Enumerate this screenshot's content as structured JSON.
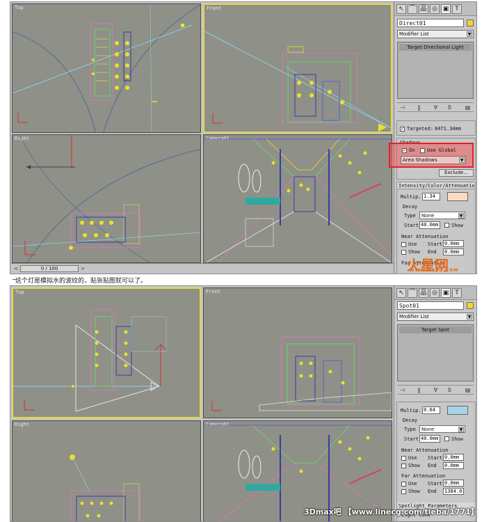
{
  "caption": "这个灯是模拟水的波纹的，贴张贴图就可以了。",
  "watermark_bottom": "3Dmax吧 【www.linecg.com/tieba/1771】",
  "watermark_logo": "火星网",
  "watermark_logo_sub": "WWW.HXSD.COM",
  "viewports": {
    "top": "Top",
    "front": "Front",
    "right": "Right",
    "camera": "Camera01"
  },
  "panel_tabs": [
    "↖",
    "⌒",
    "品",
    "◎",
    "▣",
    "T"
  ],
  "stack_icons": [
    "⊣",
    "‖",
    "∀",
    "δ",
    "▤"
  ],
  "screen1": {
    "time_slider": "0 / 100",
    "object_name": "Direct01",
    "modifier_list": "Modifier List",
    "stack_item": "Target Directional Light",
    "targeted_label": "Targeted:",
    "targeted_value": "8471.34mm",
    "shadows_header": "Shadows",
    "shadows_on": "On",
    "use_global": "Use Global",
    "shadow_type": "Area Shadows",
    "exclude_button": "Exclude...",
    "intensity_header": "Intensity/Color/Attenuation",
    "multiplier_label": "Multip.",
    "multiplier_value": "1.34",
    "decay_header": "Decay",
    "type_label": "Type",
    "type_value": "None",
    "start_label": "Start",
    "start_value": "40.0mm",
    "show_label": "Show",
    "near_atten_header": "Near Attenuation",
    "use_label": "Use",
    "near_start_value": "0.0mm",
    "end_label": "End",
    "near_end_value": "0.0mm",
    "far_atten_header": "Far Attenuation"
  },
  "screen2": {
    "object_name": "Spot01",
    "modifier_list": "Modifier List",
    "stack_item": "Target Spot",
    "multiplier_label": "Multip.",
    "multiplier_value": "0.64",
    "decay_header": "Decay",
    "type_label": "Type",
    "type_value": "None",
    "start_label": "Start",
    "start_value": "40.0mm",
    "show_label": "Show",
    "near_atten_header": "Near Attenuation",
    "use_label": "Use",
    "near_start_value": "0.0mm",
    "end_label": "End",
    "near_end_value": "0.0mm",
    "far_atten_header": "Far Attenuation",
    "far_start_value": "0.0mm",
    "far_end_value": "1384.0",
    "spotlight_header": "Spotlight Parameters",
    "light_cone_label": "Light Cone"
  },
  "colors": {
    "viewport_bg": "#8f9087",
    "active_border": "#e2d84a",
    "highlight_red": "#e1202a",
    "swatch_yellow": "#f6d52a",
    "swatch_peach": "#f7dcc4",
    "swatch_blue": "#a8d4ea"
  }
}
